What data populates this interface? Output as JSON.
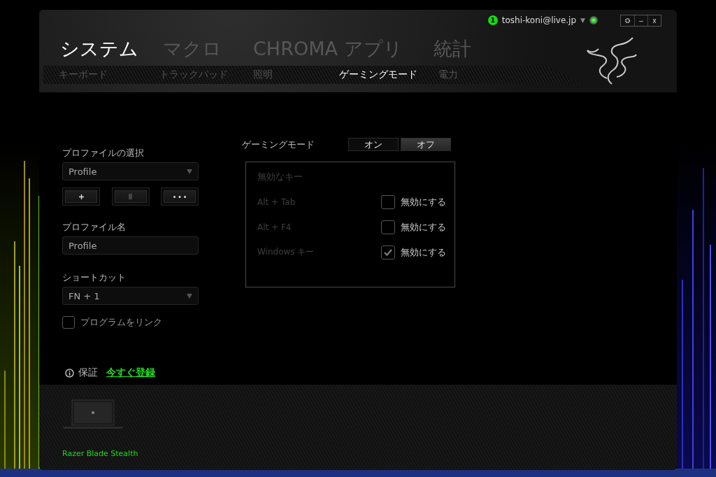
{
  "account": {
    "badge": "1",
    "email": "toshi-koni@live.jp",
    "caret": "▼"
  },
  "window_buttons": [
    "–",
    "x"
  ],
  "main_tabs": [
    {
      "label": "システム",
      "selected": true
    },
    {
      "label": "マクロ",
      "selected": false
    },
    {
      "label": "CHROMA アプリ",
      "selected": false
    },
    {
      "label": "統計",
      "selected": false
    }
  ],
  "sub_tabs": [
    {
      "label": "キーボード",
      "selected": false
    },
    {
      "label": "トラックパッド",
      "selected": false
    },
    {
      "label": "照明",
      "selected": false
    },
    {
      "label": "ゲーミングモード",
      "selected": true
    },
    {
      "label": "電力",
      "selected": false
    }
  ],
  "profile_panel": {
    "select_label": "プロファイルの選択",
    "profile_value": "Profile",
    "name_label": "プロファイル名",
    "name_value": "Profile",
    "shortcut_label": "ショートカット",
    "shortcut_value": "FN + 1",
    "link_program": {
      "label": "プログラムをリンク",
      "checked": false
    }
  },
  "gaming_mode": {
    "label": "ゲーミングモード",
    "options": [
      {
        "label": "オン",
        "selected": false
      },
      {
        "label": "オフ",
        "selected": true
      }
    ],
    "disabled_keys": {
      "title": "無効なキー",
      "rows": [
        {
          "key": "Alt + Tab",
          "label": "無効にする",
          "checked": false
        },
        {
          "key": "Alt + F4",
          "label": "無効にする",
          "checked": false
        },
        {
          "key": "Windows キー",
          "label": "無効にする",
          "checked": true
        }
      ]
    }
  },
  "warranty": {
    "label": "保証",
    "link": "今すぐ登録"
  },
  "device": {
    "name": "Razer Blade Stealth"
  }
}
